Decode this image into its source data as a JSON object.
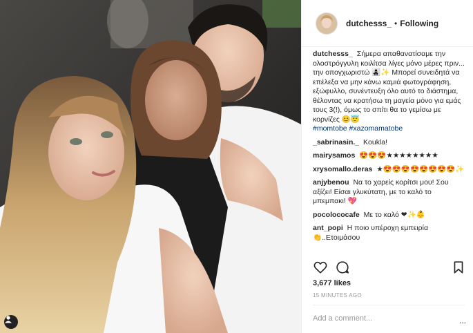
{
  "post": {
    "username": "dutchesss_",
    "separator": "•",
    "follow_status": "Following",
    "caption": {
      "user": "dutchesss_",
      "text": "Σήμερα απαθανατίσαμε την ολοστρόγγυλη κοιλίτσα λίγες μόνο μέρες πριν... την οπογχωριστώ 👩‍👧‍👦✨ Μπορεί συνειδητά να επέλεξα να μην κάνω καμιά φωτογράφηση, εξώφυλλο, συνέντευξη όλο αυτό το διάστημα, θέλοντας να κρατήσω τη μαγεία μόνο για εμάς τους 3(!), όμως το σπίτι θα το γεμίσω με κορνίζες 😊😇",
      "tag1": "#momtobe",
      "tag2": "#xazomamatobe"
    },
    "comments": [
      {
        "user": "_sabrinasin._",
        "text": "Koukla!"
      },
      {
        "user": "mairysamos",
        "text": "😍😍😍★★★★★★★★"
      },
      {
        "user": "xrysomallo.deras",
        "text": "★😍😍😍😍😍😍😍😍✨"
      },
      {
        "user": "anjybenou",
        "text": "Να το χαρείς κορίτσι μου! Σου αξίζει! Είσαι γλυκύτατη, με το καλό το μπεμπακι! 💖"
      },
      {
        "user": "pocolococafe",
        "text": "Με το καλό ❤✨👶"
      },
      {
        "user": "ant_popi",
        "text": "Η ποιο υπέροχη εμπειρία 👏..Ετοιμάσου"
      }
    ],
    "likes": "3,677 likes",
    "time": "15 MINUTES AGO",
    "add_comment_placeholder": "Add a comment...",
    "more": "..."
  },
  "colors": {
    "link": "#003569",
    "muted": "#999999",
    "text": "#262626"
  }
}
